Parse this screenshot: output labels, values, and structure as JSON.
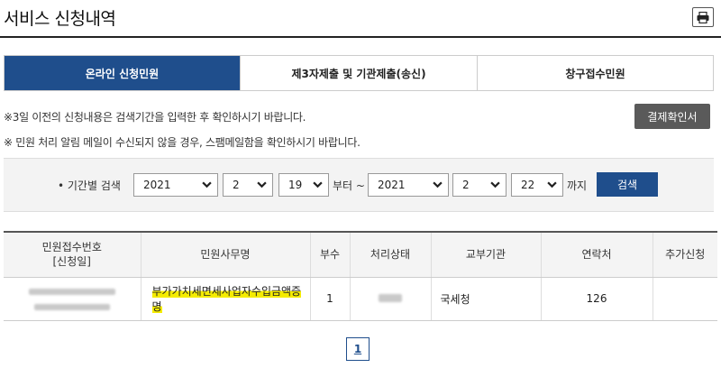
{
  "header": {
    "title": "서비스 신청내역"
  },
  "tabs": [
    {
      "label": "온라인 신청민원",
      "active": true
    },
    {
      "label": "제3자제출 및 기관제출(송신)",
      "active": false
    },
    {
      "label": "창구접수민원",
      "active": false
    }
  ],
  "notices": [
    "※3일 이전의 신청내용은 검색기간을 입력한 후 확인하시기 바랍니다.",
    "※ 민원 처리 알림 메일이 수신되지 않을 경우, 스팸메일함을 확인하시기 바랍니다."
  ],
  "receipt_button": "결제확인서",
  "search": {
    "label": "• 기간별 검색",
    "from": {
      "year": "2021",
      "month": "2",
      "day": "19"
    },
    "from_suffix": "부터 ~",
    "to": {
      "year": "2021",
      "month": "2",
      "day": "22"
    },
    "to_suffix": "까지",
    "button": "검색"
  },
  "table": {
    "headers": [
      "민원접수번호",
      "[신청일]",
      "민원사무명",
      "부수",
      "처리상태",
      "교부기관",
      "연락처",
      "추가신청"
    ],
    "rows": [
      {
        "affair": "부가가치세면세사업자수입금액증명",
        "copies": "1",
        "agency": "국세청",
        "contact": "126"
      }
    ]
  },
  "pagination": {
    "current": "1"
  },
  "colors": {
    "primary": "#1f4e8c",
    "highlight": "#f5ec00",
    "dark_button": "#5a5a5a"
  }
}
